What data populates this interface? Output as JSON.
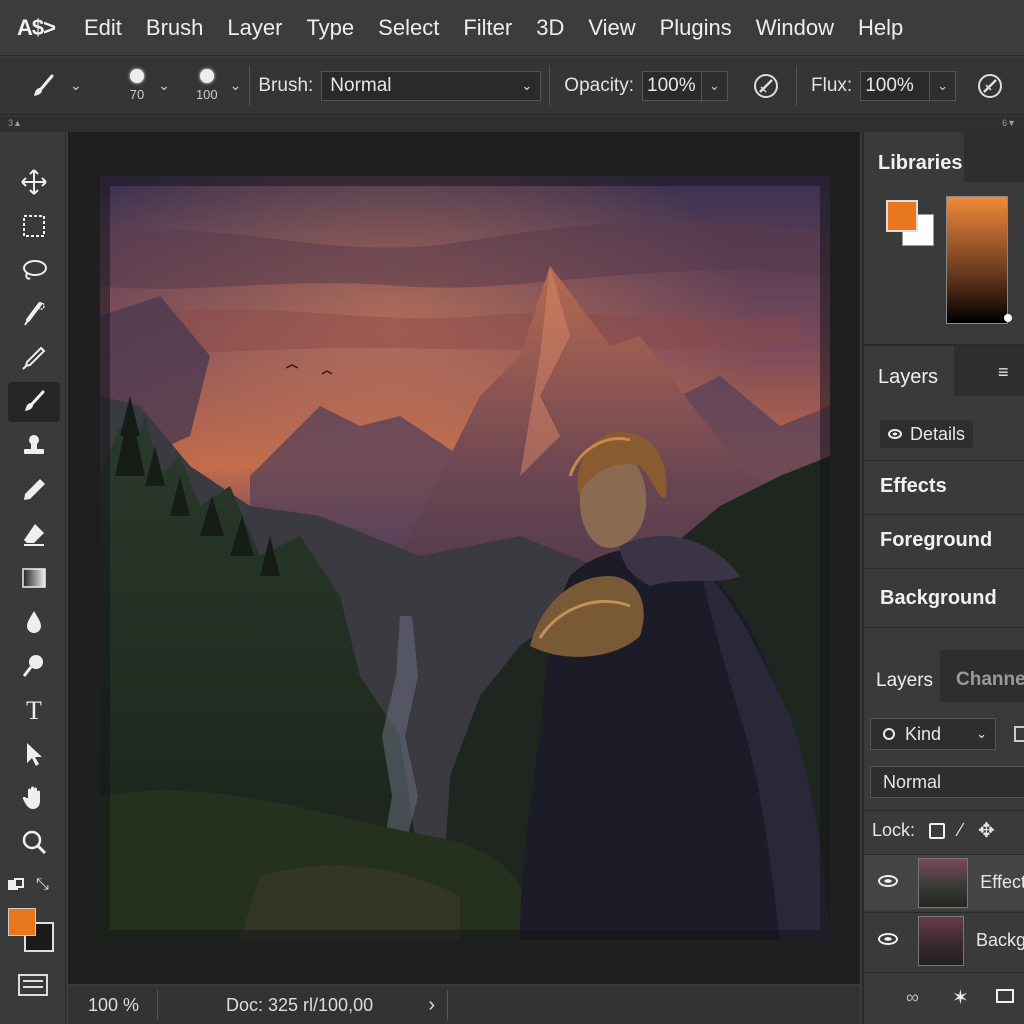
{
  "app": {
    "logo": "A$>"
  },
  "menu": [
    "Edit",
    "Brush",
    "Layer",
    "Type",
    "Select",
    "Filter",
    "3D",
    "View",
    "Plugins",
    "Window",
    "Help"
  ],
  "options": {
    "brush_size_1": "70",
    "brush_size_2": "100",
    "brush_label": "Brush:",
    "brush_mode": "Normal",
    "opacity_label": "Opacity:",
    "opacity_value": "100%",
    "flux_label": "Flux:",
    "flux_value": "100%"
  },
  "ruler": {
    "left": "3▲",
    "right": "6▼"
  },
  "tools": [
    "move",
    "marquee",
    "lasso",
    "quick-select",
    "crop",
    "brush",
    "stamp",
    "pencil",
    "eraser",
    "gradient",
    "blur",
    "dodge",
    "type",
    "path-select",
    "hand",
    "zoom"
  ],
  "colors": {
    "foreground": "#e8761e",
    "background": "#1a1a1a",
    "accent": "#e8761e"
  },
  "status": {
    "zoom": "100 %",
    "doc": "Doc: 325 rl/100,00"
  },
  "right_panel": {
    "libraries_tab": "Libraries",
    "layers_tab": "Layers",
    "details_label": "Details",
    "list": [
      "Effects",
      "Foreground",
      "Background"
    ],
    "layers_tab_2": "Layers",
    "channels_tab": "Channe",
    "kind_label": "Kind",
    "blend_mode": "Normal",
    "lock_label": "Lock:",
    "layers": [
      {
        "name": "Effect"
      },
      {
        "name": "Backg"
      }
    ]
  }
}
